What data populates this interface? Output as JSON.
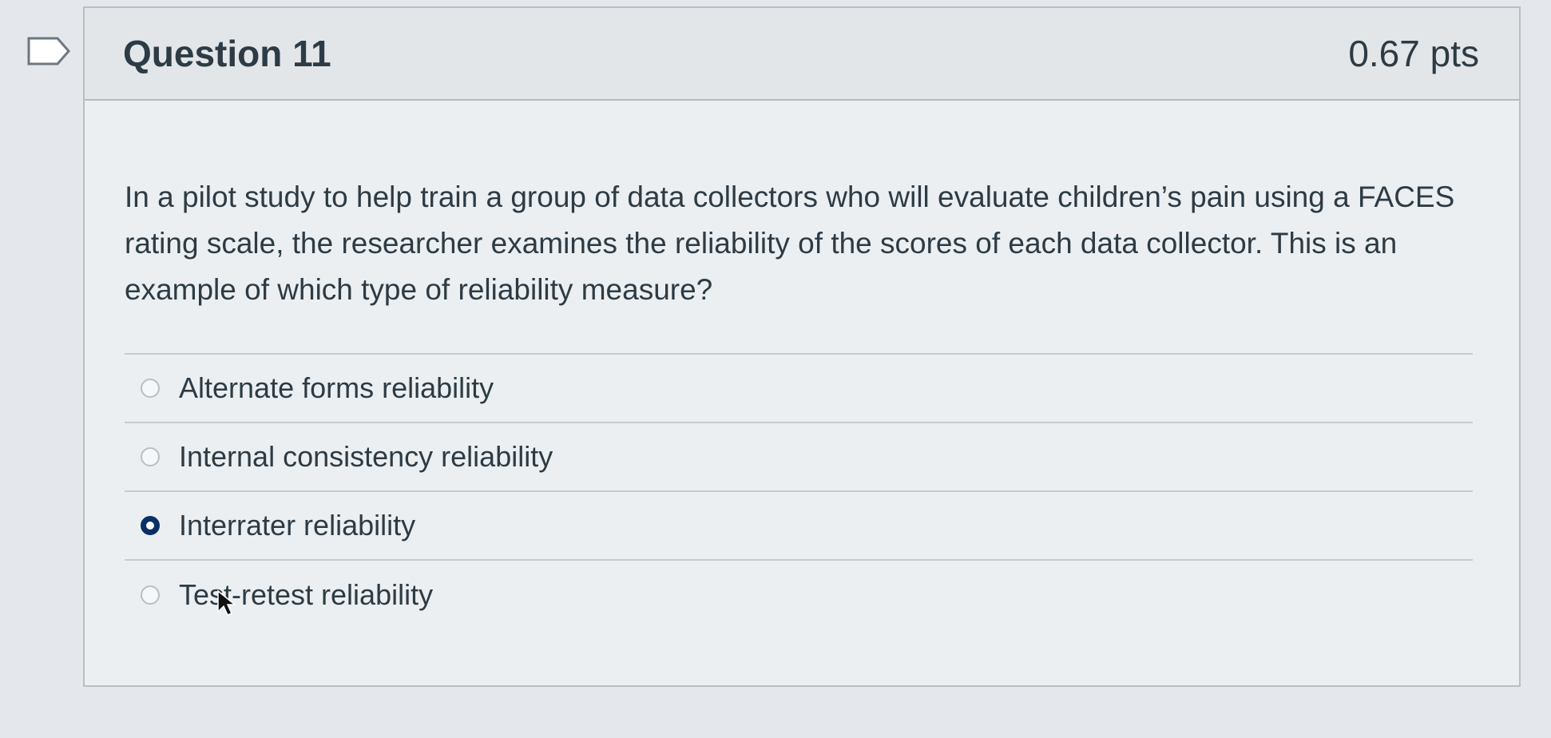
{
  "question": {
    "title": "Question 11",
    "points": "0.67 pts",
    "text": "In a pilot study to help train a group of data collectors who will evaluate children’s pain using a FACES rating scale, the researcher examines the reliability of the scores of each data collector. This is an example of which type of reliability measure?",
    "answers": [
      {
        "label": "Alternate forms reliability",
        "selected": false
      },
      {
        "label": "Internal consistency reliability",
        "selected": false
      },
      {
        "label": "Interrater reliability",
        "selected": true
      },
      {
        "label": "Test-retest reliability",
        "selected": false
      }
    ]
  },
  "icons": {
    "flag": "flag-icon",
    "cursor": "mouse-cursor-icon"
  },
  "colors": {
    "selected_radio": "#0a2f68",
    "text": "#2d3b45"
  }
}
